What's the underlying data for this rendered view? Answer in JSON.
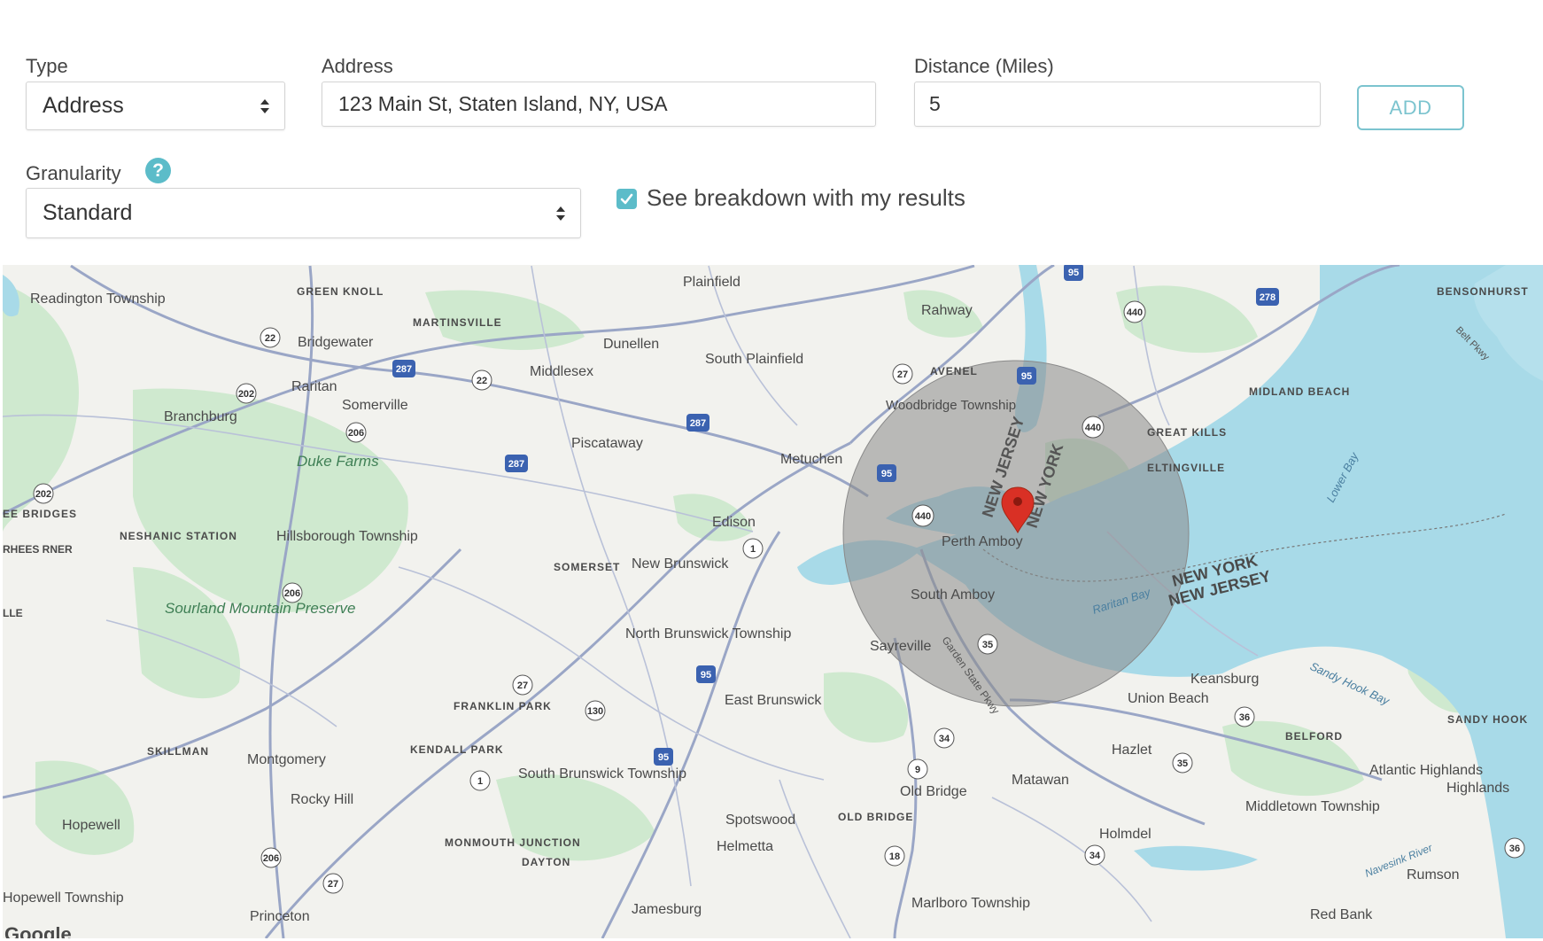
{
  "form": {
    "type": {
      "label": "Type",
      "value": "Address"
    },
    "address": {
      "label": "Address",
      "value": "123 Main St, Staten Island, NY, USA"
    },
    "distance": {
      "label": "Distance (Miles)",
      "value": "5"
    },
    "add_label": "ADD",
    "granularity": {
      "label": "Granularity",
      "help": "?",
      "value": "Standard"
    },
    "breakdown": {
      "label": "See breakdown with my results",
      "checked": true
    }
  },
  "colors": {
    "accent": "#5cbcc9",
    "add_border": "#7cc4cf",
    "radius_fill": "#8a8a8a",
    "marker": "#d93025",
    "water": "#a8dae8",
    "park": "#cfe9cf",
    "road": "#9aa6c6"
  },
  "map": {
    "attribution": "Google",
    "radius_miles": 5,
    "places": [
      "Readington Township",
      "GREEN KNOLL",
      "Plainfield",
      "Rahway",
      "BENSONHURST",
      "MARTINSVILLE",
      "Bridgewater",
      "Dunellen",
      "South Plainfield",
      "AVENEL",
      "Middlesex",
      "Raritan",
      "Somerville",
      "Branchburg",
      "Woodbridge Township",
      "MIDLAND BEACH",
      "GREAT KILLS",
      "ELTINGVILLE",
      "Duke Farms",
      "Piscataway",
      "Metuchen",
      "NEW JERSEY",
      "NEW YORK",
      "Edison",
      "Perth Amboy",
      "EE BRIDGES",
      "NESHANIC STATION",
      "Hillsborough Township",
      "RHEES RNER",
      "SOMERSET",
      "New Brunswick",
      "South Amboy",
      "Raritan Bay",
      "LLE",
      "Sourland Mountain Preserve",
      "North Brunswick Township",
      "Sayreville",
      "Garden State Pkwy",
      "Keansburg",
      "Union Beach",
      "Sandy Hook Bay",
      "SANDY HOOK",
      "FRANKLIN PARK",
      "East Brunswick",
      "BELFORD",
      "Hazlet",
      "SKILLMAN",
      "Montgomery",
      "KENDALL PARK",
      "South Brunswick Township",
      "Matawan",
      "Old Bridge",
      "Atlantic Highlands",
      "Highlands",
      "Rocky Hill",
      "Middletown Township",
      "Hopewell",
      "Spotswood",
      "OLD BRIDGE",
      "Holmdel",
      "MONMOUTH JUNCTION",
      "DAYTON",
      "Helmetta",
      "Navesink River",
      "Rumson",
      "Hopewell Township",
      "Princeton",
      "Jamesburg",
      "Marlboro Township",
      "Red Bank",
      "Lower Bay",
      "Belt Pkwy",
      "NEW YORK NEW JERSEY"
    ],
    "shields": [
      "22",
      "287",
      "22",
      "202",
      "206",
      "287",
      "287",
      "202",
      "206",
      "206",
      "27",
      "130",
      "95",
      "1",
      "27",
      "95",
      "440",
      "440",
      "95",
      "95",
      "440",
      "278",
      "35",
      "36",
      "35",
      "34",
      "9",
      "18",
      "34",
      "36",
      "206",
      "27",
      "95"
    ]
  }
}
